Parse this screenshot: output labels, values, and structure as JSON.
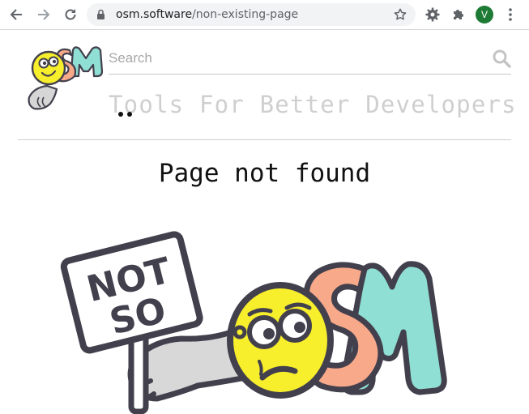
{
  "browser": {
    "url_host": "osm.software",
    "url_path": "/non-existing-page",
    "profile_initial": "V",
    "profile_color": "#1e7b35"
  },
  "header": {
    "search_placeholder": "Search",
    "tagline": "Tools For Better Developers"
  },
  "main": {
    "heading": "Page not found",
    "sign_line1": "NOT",
    "sign_line2": "SO"
  },
  "colors": {
    "logo_yellow": "#f7ee2c",
    "logo_orange": "#f8a98a",
    "logo_teal": "#8fdfd4",
    "outline": "#43404d"
  }
}
